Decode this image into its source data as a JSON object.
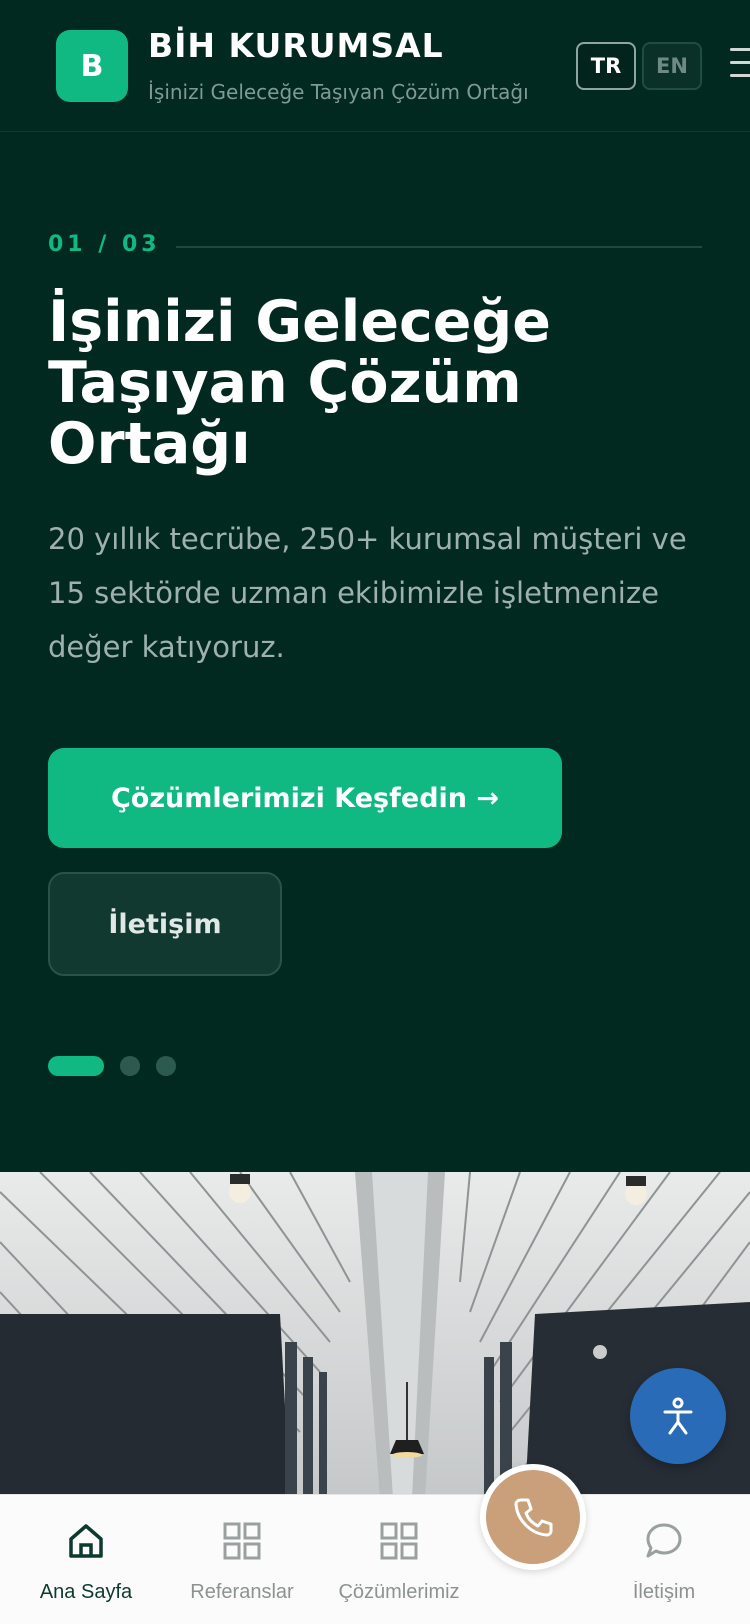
{
  "header": {
    "logo_letter": "B",
    "brand_name": "BİH KURUMSAL",
    "tagline": "İşinizi Geleceğe Taşıyan Çözüm Ortağı",
    "languages": [
      "TR",
      "EN"
    ],
    "active_language": "TR"
  },
  "hero": {
    "counter": "01 / 03",
    "title": "İşinizi Geleceğe Taşıyan Çözüm Ortağı",
    "subtitle": "20 yıllık tecrübe, 250+ kurumsal müşteri ve 15 sektörde uzman ekibimizle işletmenize değer katıyoruz.",
    "primary_cta": "Çözümlerimizi Keşfedin →",
    "secondary_cta": "İletişim",
    "slide_count": 3,
    "active_slide": 1
  },
  "bottom_nav": {
    "items": [
      {
        "label": "Ana Sayfa",
        "icon": "home-icon",
        "active": true
      },
      {
        "label": "Referanslar",
        "icon": "grid-icon",
        "active": false
      },
      {
        "label": "Çözümlerimiz",
        "icon": "grid-icon",
        "active": false
      },
      {
        "label": "İletişim",
        "icon": "chat-icon",
        "active": false
      }
    ],
    "call_icon": "phone-icon"
  },
  "colors": {
    "background": "#022920",
    "accent": "#10b981",
    "call_button": "#c9a07a",
    "accessibility_button": "#2a6bb7"
  }
}
